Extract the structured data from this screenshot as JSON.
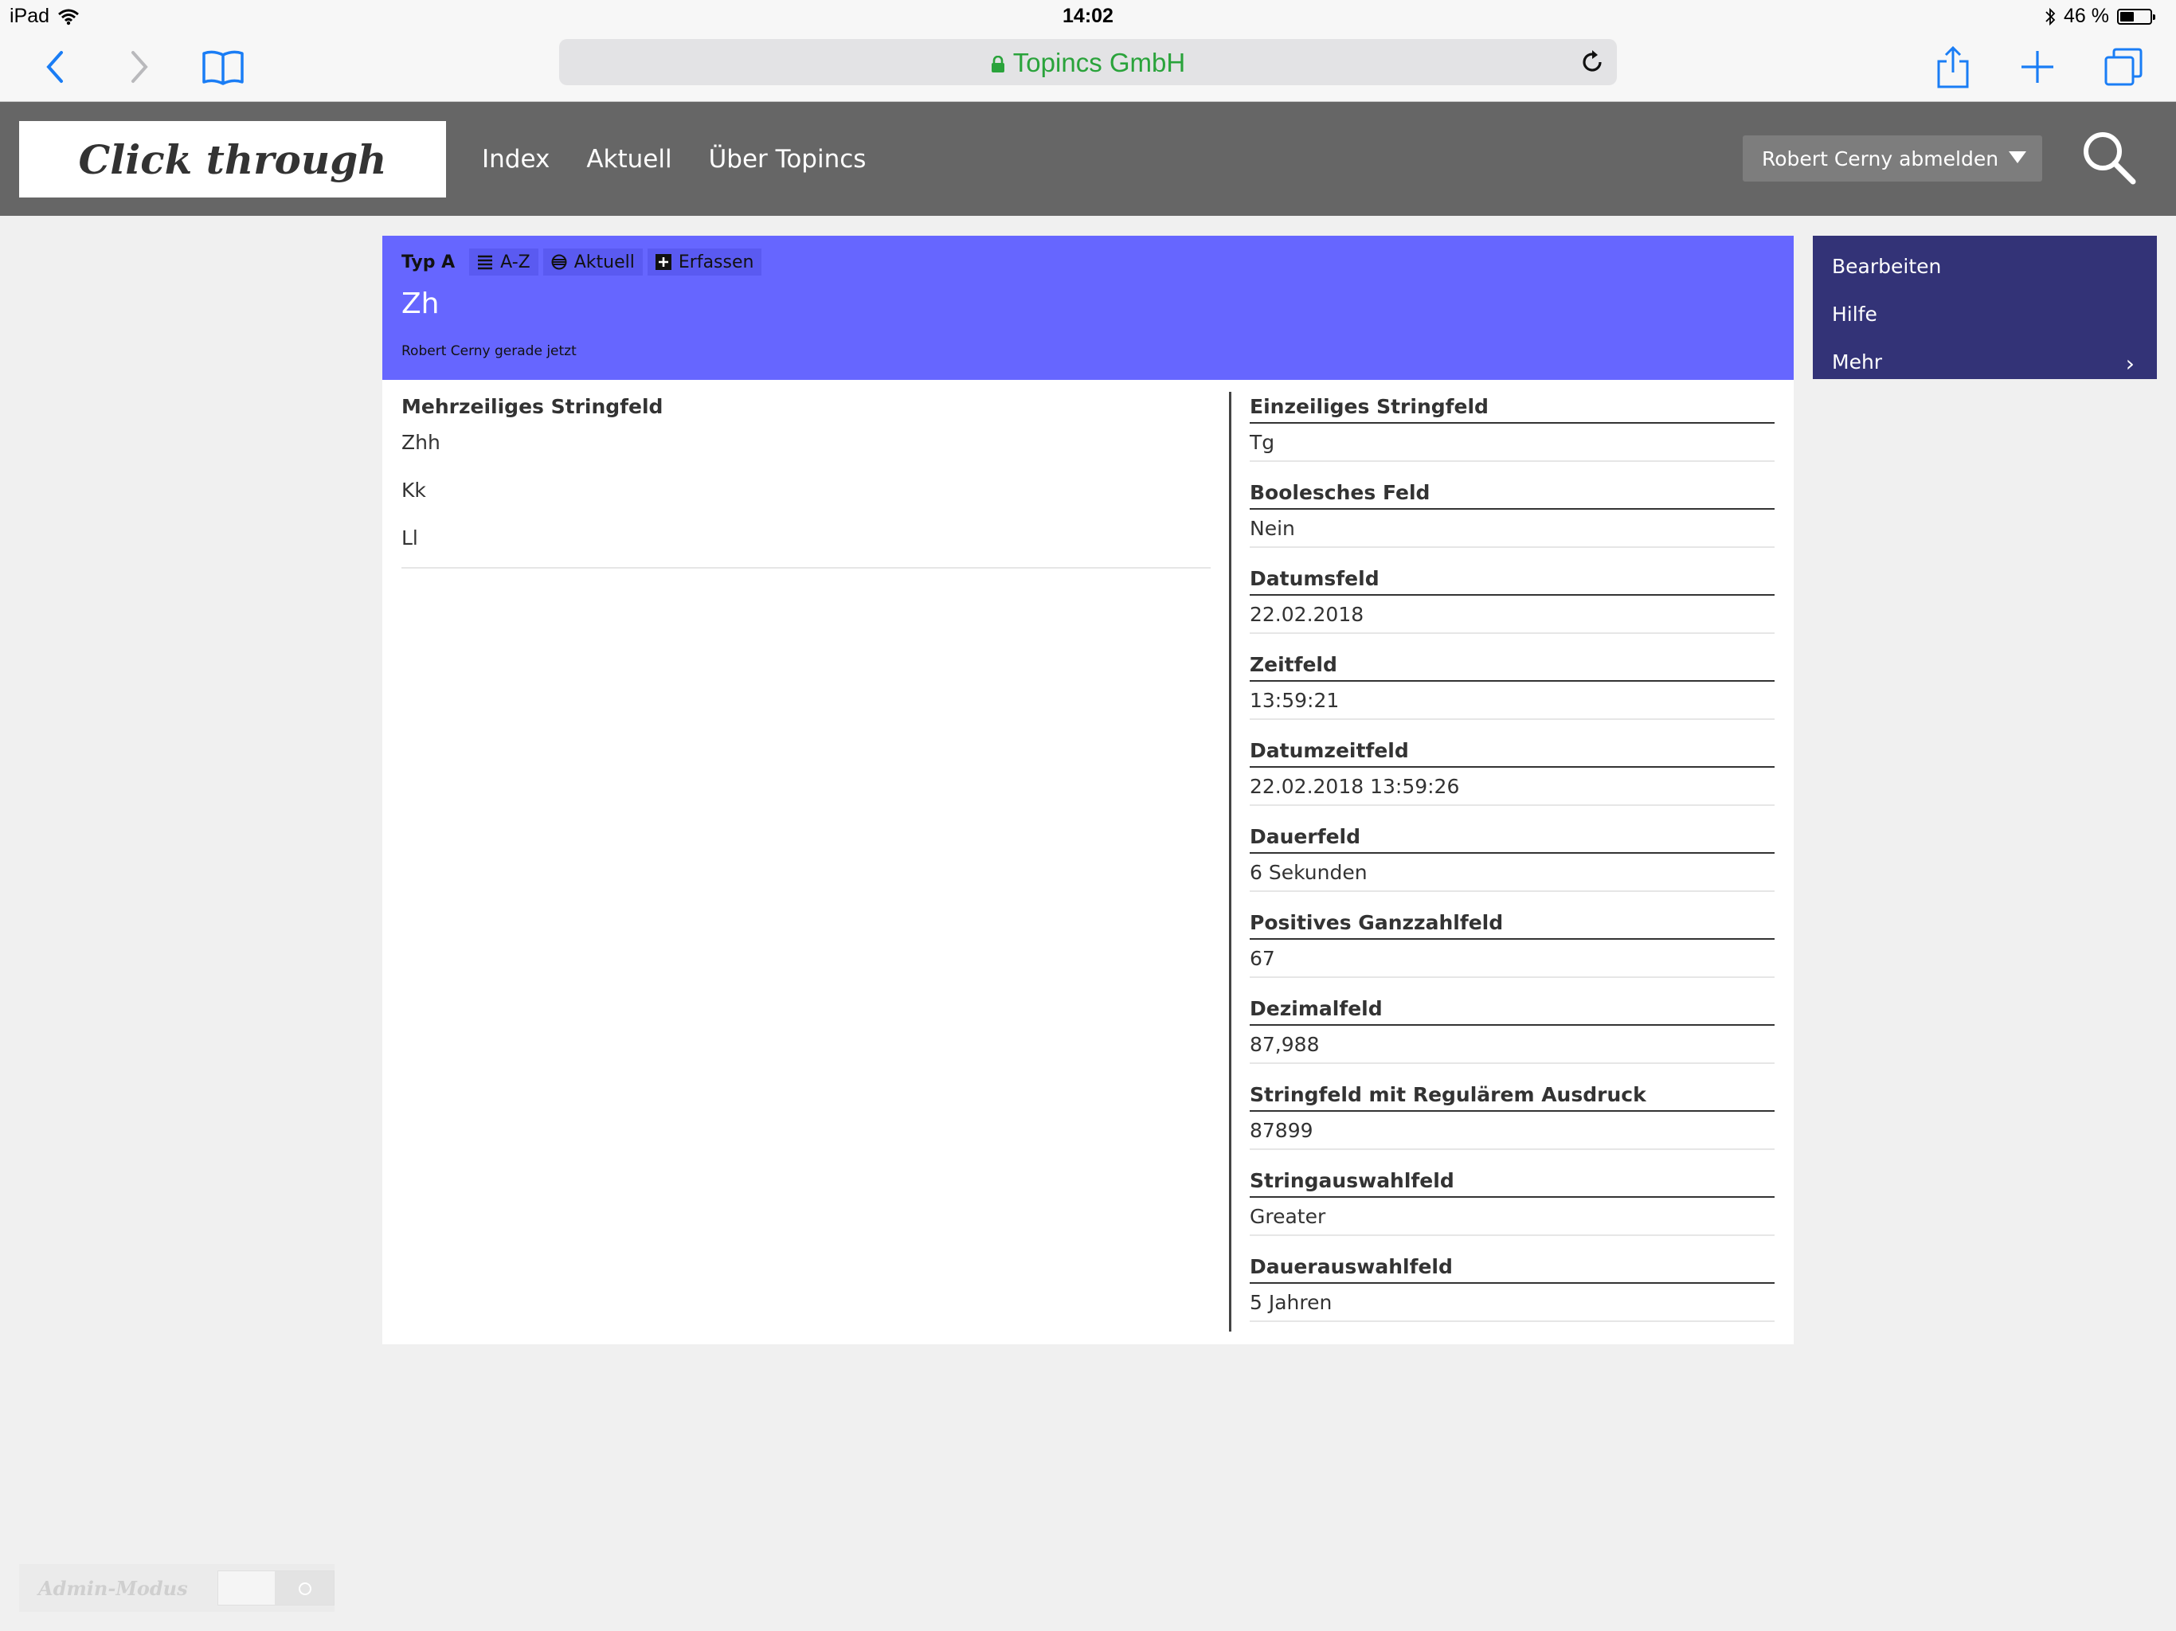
{
  "status_bar": {
    "device": "iPad",
    "time": "14:02",
    "battery": "46 %",
    "battery_level": 0.46
  },
  "browser": {
    "url_display": "Topincs GmbH",
    "url_color": "#2aa33b"
  },
  "site": {
    "logo": "Click through",
    "nav": [
      "Index",
      "Aktuell",
      "Über Topincs"
    ],
    "user_menu": "Robert Cerny abmelden",
    "header_color": "#666666"
  },
  "record": {
    "type": "Typ A",
    "actions": {
      "az": "A-Z",
      "recent": "Aktuell",
      "create": "Erfassen"
    },
    "title": "Zh",
    "meta": "Robert Cerny gerade jetzt",
    "header_color": "#6666ff"
  },
  "left_fields": {
    "multiline": {
      "label": "Mehrzeiliges Stringfeld",
      "values": [
        "Zhh",
        "Kk",
        "Ll"
      ]
    }
  },
  "right_fields": [
    {
      "label": "Einzeiliges Stringfeld",
      "value": "Tg"
    },
    {
      "label": "Boolesches Feld",
      "value": "Nein"
    },
    {
      "label": "Datumsfeld",
      "value": "22.02.2018"
    },
    {
      "label": "Zeitfeld",
      "value": "13:59:21"
    },
    {
      "label": "Datumzeitfeld",
      "value": "22.02.2018 13:59:26"
    },
    {
      "label": "Dauerfeld",
      "value": "6 Sekunden"
    },
    {
      "label": "Positives Ganzzahlfeld",
      "value": "67"
    },
    {
      "label": "Dezimalfeld",
      "value": "87,988"
    },
    {
      "label": "Stringfeld mit Regulärem Ausdruck",
      "value": "87899"
    },
    {
      "label": "Stringauswahlfeld",
      "value": "Greater"
    },
    {
      "label": "Dauerauswahlfeld",
      "value": "5 Jahren"
    }
  ],
  "side_menu": {
    "items": [
      "Bearbeiten",
      "Hilfe",
      "Mehr"
    ],
    "color": "#333377"
  },
  "admin": {
    "label": "Admin-Modus"
  }
}
